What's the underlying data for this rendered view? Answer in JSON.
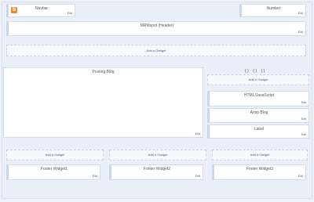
{
  "navbar": {
    "title": "Navbar",
    "edit": "Edit",
    "icon": "blogger-icon"
  },
  "number": {
    "title": "Number",
    "edit": "Edit"
  },
  "header": {
    "title": "MRMspot (Header)",
    "edit": "Edit"
  },
  "add_gadget": "Add a Gadget",
  "blog_posts": {
    "title": "Posting Blog",
    "edit": "Edit"
  },
  "sidebar": {
    "tabs": [
      "{",
      "}",
      "{",
      "}",
      "{",
      "}"
    ],
    "widgets": [
      {
        "title": "HTML/JavaScript",
        "edit": "Edit"
      },
      {
        "title": "Arsip Blog",
        "edit": "Edit"
      },
      {
        "title": "Label",
        "edit": "Edit"
      }
    ]
  },
  "footer": {
    "widgets": [
      {
        "title": "Footer Widget1",
        "edit": "Edit"
      },
      {
        "title": "Footer Widget2",
        "edit": "Edit"
      },
      {
        "title": "Footer Widget3",
        "edit": "Edit"
      }
    ]
  },
  "colors": {
    "background": "#eef3fb",
    "widget": "#ffffff",
    "link": "#3a5a9a",
    "accent": "#f5841f"
  }
}
